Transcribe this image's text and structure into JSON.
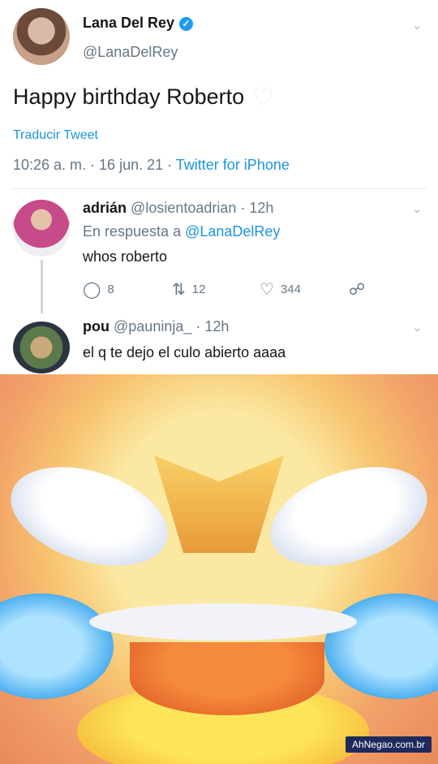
{
  "tweet": {
    "author_name": "Lana Del Rey",
    "author_handle": "@LanaDelRey",
    "text": "Happy birthday Roberto",
    "heart_emoji": "♡",
    "translate_link": "Traducir Tweet",
    "time": "10:26 a. m. · 16 jun. 21 · ",
    "source": "Twitter for iPhone"
  },
  "replies": [
    {
      "name": "adrián",
      "handle": "@losientoadrian · 12h",
      "in_reply_prefix": "En respuesta a ",
      "in_reply_handle": "@LanaDelRey",
      "text": "whos roberto",
      "reply_count": "8",
      "retweet_count": "12",
      "like_count": "344"
    },
    {
      "name": "pou",
      "handle": "@pauninja_ · 12h",
      "text": "el q te dejo el culo abierto aaaa"
    }
  ],
  "watermark": "AhNegao.com.br",
  "icons": {
    "verified": "verified-badge-icon",
    "chevron": "chevron-down-icon",
    "reply": "reply-icon",
    "retweet": "retweet-icon",
    "like": "heart-icon",
    "share": "share-icon"
  },
  "colors": {
    "link": "#1b95e0",
    "muted": "#657786",
    "verified": "#1d9bf0"
  }
}
